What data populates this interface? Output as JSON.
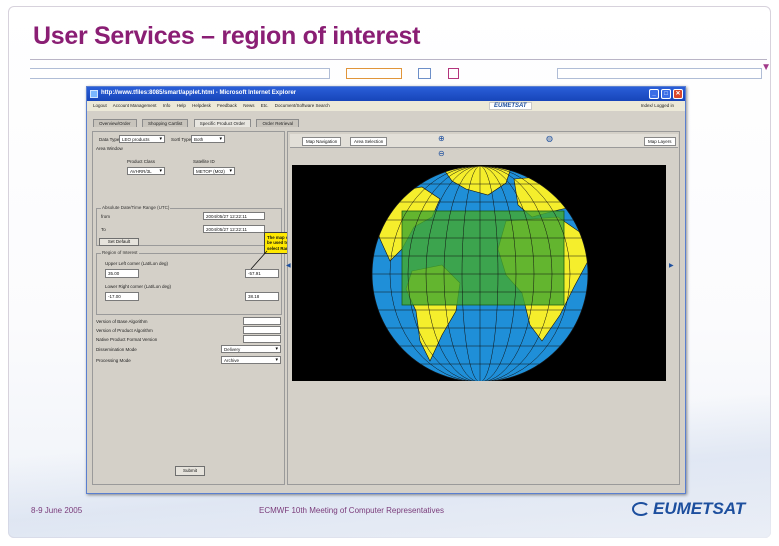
{
  "slide": {
    "title": "User Services – region of interest",
    "footer_date": "8-9 June 2005",
    "footer_center": "ECMWF 10th Meeting of Computer Representatives",
    "footer_logo": "EUMETSAT"
  },
  "window": {
    "title": "http://www.tfiles:8085/smart/applet.html - Microsoft Internet Explorer",
    "menu": [
      "Logout",
      "Account Management",
      "Info",
      "Help",
      "Helpdesk",
      "Feedback",
      "News",
      "Etc.",
      "Document/Software Search"
    ],
    "menu_logo": "EUMETSAT",
    "menu_right": "Index/ Logged in",
    "tabs": [
      "Overview/Order",
      "Shopping Cartlist",
      "Specific Product Order",
      "Order Retrieval"
    ],
    "active_tab_index": 2
  },
  "left_panel": {
    "data_type_label": "Data Type:",
    "data_type_value": "LEO products",
    "sort_type_label": "Sortl Type:",
    "sort_type_value": "Both",
    "area_window_label": "Area Window",
    "product_class_label": "Product Class",
    "product_class_value": "AVHRR/3L",
    "satellite_label": "Satellite ID",
    "satellite_value": "METOP (M02)",
    "date_range_label": "Absolute Date/Time Range (UTC)",
    "from_label": "from",
    "from_value": "2004/05/27 12:22:11",
    "to_label": "To",
    "to_value": "2004/05/27 12:22:11",
    "set_default_label": "Set Default",
    "roi_label": "Region of Interest",
    "upper_left_label": "Upper Left corner (Lat/Lon deg)",
    "upper_left_lat": "35.00",
    "upper_left_lon": "-57.91",
    "lower_right_label": "Lower Right corner (Lat/Lon deg)",
    "lower_right_lat": "-17.00",
    "lower_right_lon": "38.18",
    "version_base_label": "Version of Base Algorithm",
    "version_product_label": "Version of Product Algorithm",
    "native_format_label": "Native Product Format Version",
    "dissemination_label": "Dissemination Mode",
    "dissemination_value": "Delivery",
    "processing_label": "Processing Mode",
    "processing_value": "Archive",
    "submit_label": "Submit",
    "callout_text": "The map can be used to select Ranges"
  },
  "right_panel": {
    "map_nav_label": "Map Navigation",
    "area_selection_label": "Area Selection",
    "map_layers_label": "Map Layers"
  },
  "colors": {
    "title": "#8a1e74",
    "ocean": "#1f8fd8",
    "land": "#f5ee2c",
    "selection": "#43a82f",
    "space": "#000000"
  }
}
